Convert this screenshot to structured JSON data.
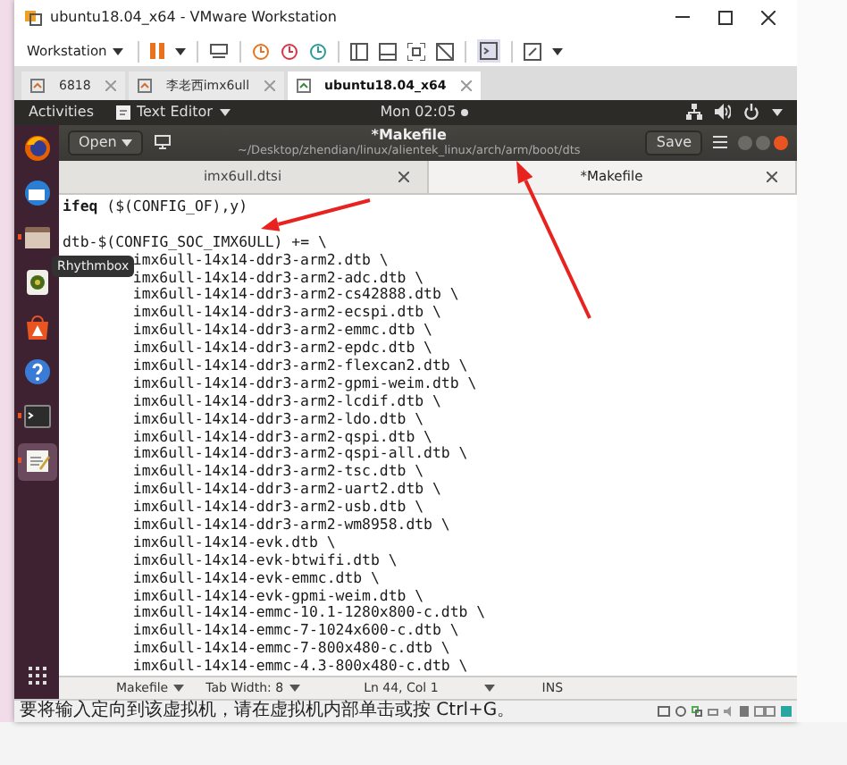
{
  "window": {
    "title": "ubuntu18.04_x64 - VMware Workstation"
  },
  "toolbar": {
    "menu": "Workstation"
  },
  "vm_tabs": [
    {
      "label": "6818",
      "selected": false
    },
    {
      "label": "李老西imx6ull",
      "selected": false
    },
    {
      "label": "ubuntu18.04_x64",
      "selected": true
    }
  ],
  "top_bar": {
    "activities": "Activities",
    "app_menu": "Text Editor",
    "clock": "Mon 02:05"
  },
  "dock": [
    {
      "kind": "browser",
      "running": false,
      "selected": false
    },
    {
      "kind": "mail",
      "running": false,
      "selected": false
    },
    {
      "kind": "files",
      "running": true,
      "selected": false
    },
    {
      "kind": "music",
      "running": false,
      "selected": false
    },
    {
      "kind": "store",
      "running": false,
      "selected": false
    },
    {
      "kind": "help",
      "running": false,
      "selected": false
    },
    {
      "kind": "terminal",
      "running": true,
      "selected": false
    },
    {
      "kind": "editor",
      "running": true,
      "selected": true
    }
  ],
  "dock_tooltip": "Rhythmbox",
  "header": {
    "open": "Open",
    "title": "*Makefile",
    "subtitle": "~/Desktop/zhendian/linux/alientek_linux/arch/arm/boot/dts",
    "save": "Save"
  },
  "doc_tabs": [
    {
      "label": "imx6ull.dtsi",
      "selected": false
    },
    {
      "label": "*Makefile",
      "selected": true
    }
  ],
  "code_lines": [
    {
      "kind": "code",
      "text": "**ifeq** ($(CONFIG_OF),y)"
    },
    {
      "kind": "blank"
    },
    {
      "kind": "code",
      "text": "dtb-$(CONFIG_SOC_IMX6ULL) += \\"
    },
    {
      "kind": "indented",
      "text": "imx6ull-14x14-ddr3-arm2.dtb \\"
    },
    {
      "kind": "indented",
      "text": "imx6ull-14x14-ddr3-arm2-adc.dtb \\"
    },
    {
      "kind": "indented",
      "text": "imx6ull-14x14-ddr3-arm2-cs42888.dtb \\"
    },
    {
      "kind": "indented",
      "text": "imx6ull-14x14-ddr3-arm2-ecspi.dtb \\"
    },
    {
      "kind": "indented",
      "text": "imx6ull-14x14-ddr3-arm2-emmc.dtb \\"
    },
    {
      "kind": "indented",
      "text": "imx6ull-14x14-ddr3-arm2-epdc.dtb \\"
    },
    {
      "kind": "indented",
      "text": "imx6ull-14x14-ddr3-arm2-flexcan2.dtb \\"
    },
    {
      "kind": "indented",
      "text": "imx6ull-14x14-ddr3-arm2-gpmi-weim.dtb \\"
    },
    {
      "kind": "indented",
      "text": "imx6ull-14x14-ddr3-arm2-lcdif.dtb \\"
    },
    {
      "kind": "indented",
      "text": "imx6ull-14x14-ddr3-arm2-ldo.dtb \\"
    },
    {
      "kind": "indented",
      "text": "imx6ull-14x14-ddr3-arm2-qspi.dtb \\"
    },
    {
      "kind": "indented",
      "text": "imx6ull-14x14-ddr3-arm2-qspi-all.dtb \\"
    },
    {
      "kind": "indented",
      "text": "imx6ull-14x14-ddr3-arm2-tsc.dtb \\"
    },
    {
      "kind": "indented",
      "text": "imx6ull-14x14-ddr3-arm2-uart2.dtb \\"
    },
    {
      "kind": "indented",
      "text": "imx6ull-14x14-ddr3-arm2-usb.dtb \\"
    },
    {
      "kind": "indented",
      "text": "imx6ull-14x14-ddr3-arm2-wm8958.dtb \\"
    },
    {
      "kind": "indented",
      "text": "imx6ull-14x14-evk.dtb \\"
    },
    {
      "kind": "indented",
      "text": "imx6ull-14x14-evk-btwifi.dtb \\"
    },
    {
      "kind": "indented",
      "text": "imx6ull-14x14-evk-emmc.dtb \\"
    },
    {
      "kind": "indented",
      "text": "imx6ull-14x14-evk-gpmi-weim.dtb \\"
    },
    {
      "kind": "indented",
      "text": "imx6ull-14x14-emmc-10.1-1280x800-c.dtb \\"
    },
    {
      "kind": "indented",
      "text": "imx6ull-14x14-emmc-7-1024x600-c.dtb \\"
    },
    {
      "kind": "indented",
      "text": "imx6ull-14x14-emmc-7-800x480-c.dtb \\"
    },
    {
      "kind": "indented",
      "text": "imx6ull-14x14-emmc-4.3-800x480-c.dtb \\"
    }
  ],
  "editor_status": {
    "language": "Makefile",
    "tab_width": "Tab Width: 8",
    "position": "Ln 44, Col 1",
    "mode": "INS"
  },
  "vm_status": {
    "message": "要将输入定向到该虚拟机，请在虚拟机内部单击或按 Ctrl+G。"
  }
}
